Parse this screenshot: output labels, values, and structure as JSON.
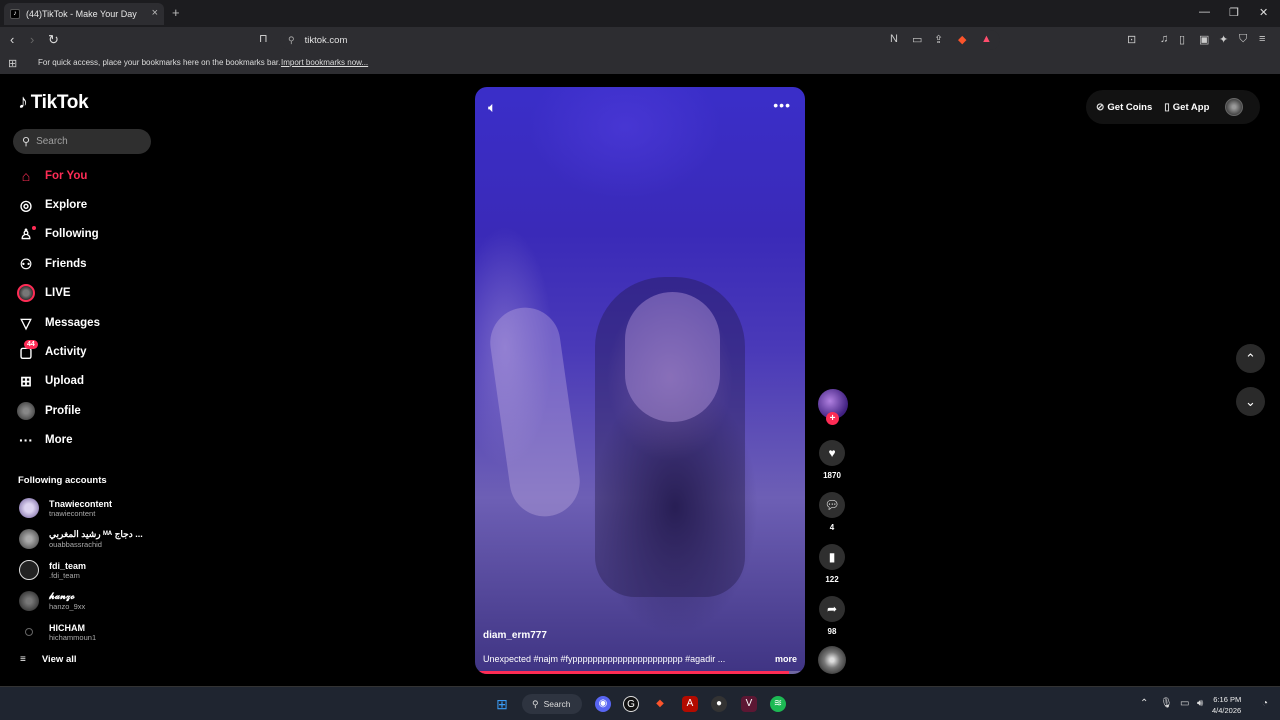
{
  "browser": {
    "tab_title": "(44)TikTok - Make Your Day",
    "tab_close": "×",
    "new_tab": "+",
    "url": "tiktok.com",
    "bookmarks_message": "For quick access, place your bookmarks here on the bookmarks bar.",
    "bookmarks_import": "Import bookmarks now..."
  },
  "tiktok": {
    "logo": "TikTok",
    "search_placeholder": "Search",
    "nav": [
      {
        "label": "For You",
        "icon": "home-icon"
      },
      {
        "label": "Explore",
        "icon": "compass-icon"
      },
      {
        "label": "Following",
        "icon": "person-follow-icon"
      },
      {
        "label": "Friends",
        "icon": "friends-icon"
      },
      {
        "label": "LIVE",
        "icon": "live-icon"
      },
      {
        "label": "Messages",
        "icon": "send-icon"
      },
      {
        "label": "Activity",
        "icon": "inbox-icon",
        "badge": "44"
      },
      {
        "label": "Upload",
        "icon": "plus-square-icon"
      },
      {
        "label": "Profile",
        "icon": "avatar-icon"
      },
      {
        "label": "More",
        "icon": "ellipsis-icon"
      }
    ],
    "following_title": "Following accounts",
    "accounts": [
      {
        "name": "Tnawiecontent",
        "handle": "tnawiecontent"
      },
      {
        "name": "رشيد المغربي ᴹᴬ دجاج ...",
        "handle": "ouabbassrachid"
      },
      {
        "name": "fdi_team",
        "handle": ".fdi_team"
      },
      {
        "name": "𝓱𝓪𝓷𝔃𝓸",
        "handle": "hanzo_9xx"
      },
      {
        "name": "HICHAM",
        "handle": "hichammoun1"
      }
    ],
    "view_all": "View all",
    "top_right": {
      "coins": "Get Coins",
      "app": "Get App"
    },
    "video": {
      "author": "diam_erm777",
      "caption": "Unexpected #najm #fypppppppppppppppppppppp #agadir ...",
      "caption_more": "more",
      "progress": 0.95
    },
    "actions": {
      "likes": "1870",
      "comments": "4",
      "saves": "122",
      "shares": "98"
    }
  },
  "taskbar": {
    "search": "Search",
    "time": "6:16 PM",
    "date": "4/4/2026"
  },
  "colors": {
    "accent": "#fe2c55",
    "background": "#000000"
  }
}
